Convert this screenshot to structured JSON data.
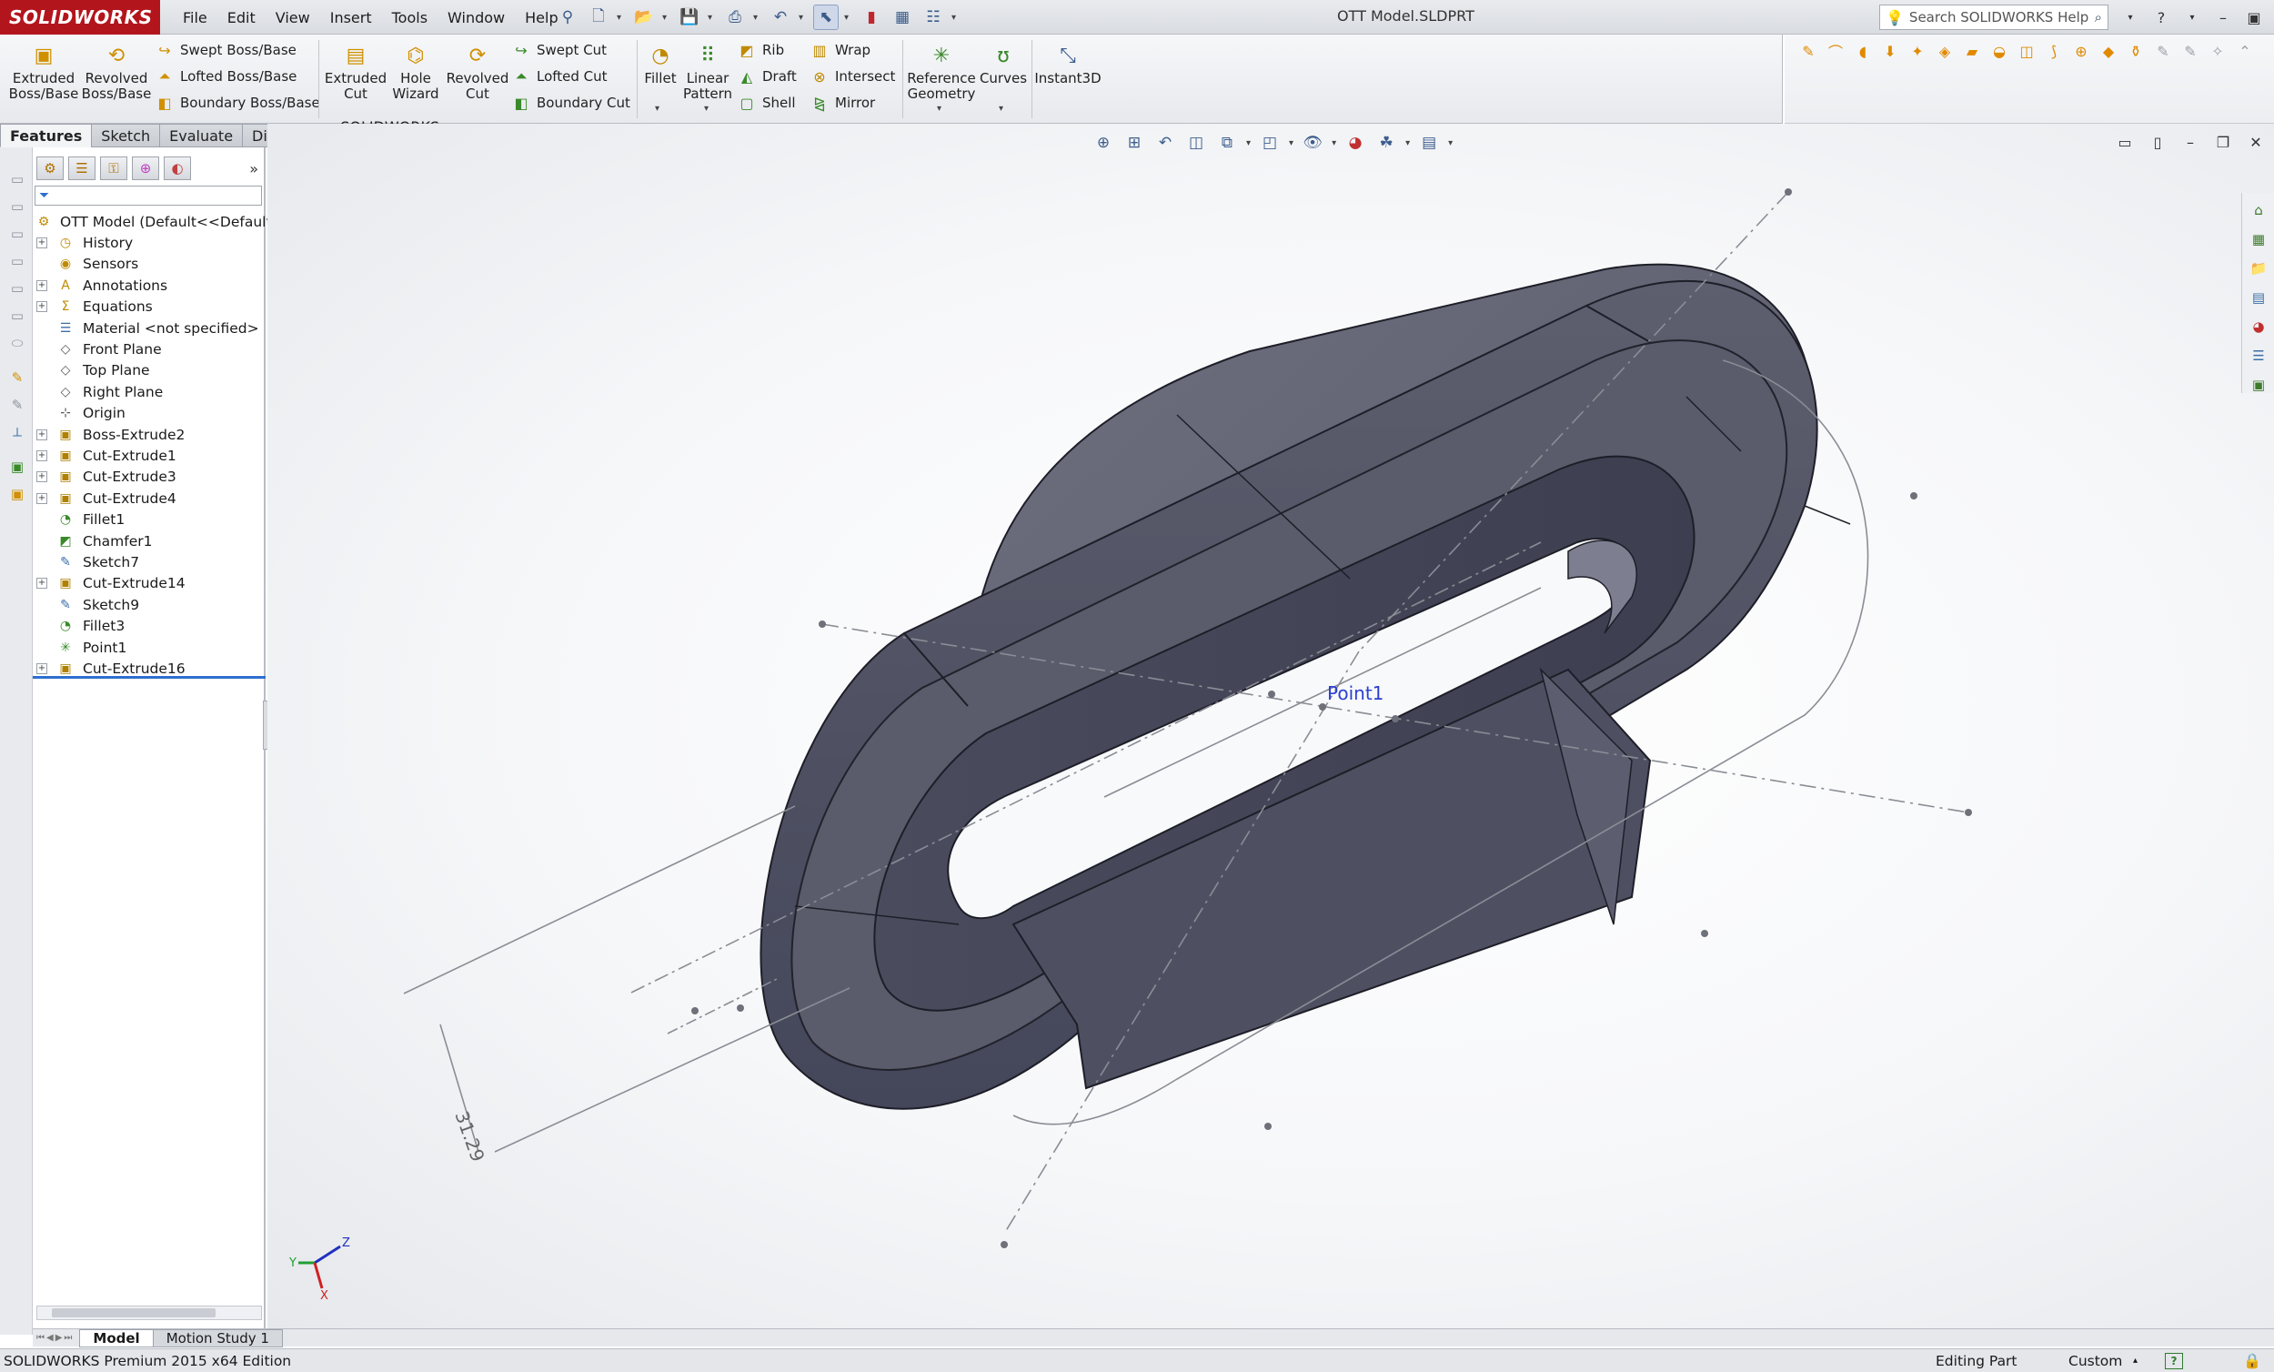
{
  "app": {
    "logo": "SOLIDWORKS",
    "document_title": "OTT Model.SLDPRT",
    "menus": [
      "File",
      "Edit",
      "View",
      "Insert",
      "Tools",
      "Window",
      "Help"
    ],
    "search_placeholder": "Search SOLIDWORKS Help"
  },
  "command_manager": {
    "extruded_boss": "Extruded\nBoss/Base",
    "revolved_boss": "Revolved\nBoss/Base",
    "swept_boss": "Swept Boss/Base",
    "lofted_boss": "Lofted Boss/Base",
    "boundary_boss": "Boundary Boss/Base",
    "extruded_cut": "Extruded\nCut",
    "hole_wizard": "Hole\nWizard",
    "revolved_cut": "Revolved\nCut",
    "swept_cut": "Swept Cut",
    "lofted_cut": "Lofted Cut",
    "boundary_cut": "Boundary Cut",
    "fillet": "Fillet",
    "linear_pattern": "Linear\nPattern",
    "rib": "Rib",
    "draft": "Draft",
    "shell": "Shell",
    "wrap": "Wrap",
    "intersect": "Intersect",
    "mirror": "Mirror",
    "reference_geometry": "Reference\nGeometry",
    "curves": "Curves",
    "instant3d": "Instant3D"
  },
  "tabs": [
    "Features",
    "Sketch",
    "Evaluate",
    "DimXpert",
    "SOLIDWORKS Add-Ins"
  ],
  "active_tab": "Features",
  "feature_tree": {
    "root": "OTT Model  (Default<<Default>_",
    "items": [
      {
        "label": "History",
        "icon": "history-icon",
        "expandable": true
      },
      {
        "label": "Sensors",
        "icon": "sensors-icon",
        "expandable": false
      },
      {
        "label": "Annotations",
        "icon": "annotations-icon",
        "expandable": true
      },
      {
        "label": "Equations",
        "icon": "equations-icon",
        "expandable": true
      },
      {
        "label": "Material <not specified>",
        "icon": "material-icon",
        "expandable": false
      },
      {
        "label": "Front Plane",
        "icon": "plane-icon",
        "expandable": false
      },
      {
        "label": "Top Plane",
        "icon": "plane-icon",
        "expandable": false
      },
      {
        "label": "Right Plane",
        "icon": "plane-icon",
        "expandable": false
      },
      {
        "label": "Origin",
        "icon": "origin-icon",
        "expandable": false
      },
      {
        "label": "Boss-Extrude2",
        "icon": "extrude-icon",
        "expandable": true
      },
      {
        "label": "Cut-Extrude1",
        "icon": "extrude-icon",
        "expandable": true
      },
      {
        "label": "Cut-Extrude3",
        "icon": "extrude-icon",
        "expandable": true
      },
      {
        "label": "Cut-Extrude4",
        "icon": "extrude-icon",
        "expandable": true
      },
      {
        "label": "Fillet1",
        "icon": "fillet-icon",
        "expandable": false
      },
      {
        "label": "Chamfer1",
        "icon": "chamfer-icon",
        "expandable": false
      },
      {
        "label": "Sketch7",
        "icon": "sketch-icon",
        "expandable": false
      },
      {
        "label": "Cut-Extrude14",
        "icon": "extrude-icon",
        "expandable": true
      },
      {
        "label": "Sketch9",
        "icon": "sketch-icon",
        "expandable": false
      },
      {
        "label": "Fillet3",
        "icon": "fillet-icon",
        "expandable": false
      },
      {
        "label": "Point1",
        "icon": "point-icon",
        "expandable": false
      },
      {
        "label": "Cut-Extrude16",
        "icon": "extrude-icon",
        "expandable": true
      }
    ]
  },
  "viewport": {
    "point_label": "Point1",
    "dimension_label": "31.29",
    "triad": {
      "x": "X",
      "y": "Y",
      "z": "Z"
    }
  },
  "bottom_tabs": [
    "Model",
    "Motion Study 1"
  ],
  "active_bottom_tab": "Model",
  "status": {
    "edition": "SOLIDWORKS Premium 2015 x64 Edition",
    "mode": "Editing Part",
    "units": "Custom",
    "help": "?"
  },
  "colors": {
    "brand": "#b3151d",
    "model_face_dark": "#4a4c5a",
    "model_face_light": "#6a6c7c",
    "point_label": "#2c3fd1",
    "tree_highlight": "#2d6fd0"
  }
}
